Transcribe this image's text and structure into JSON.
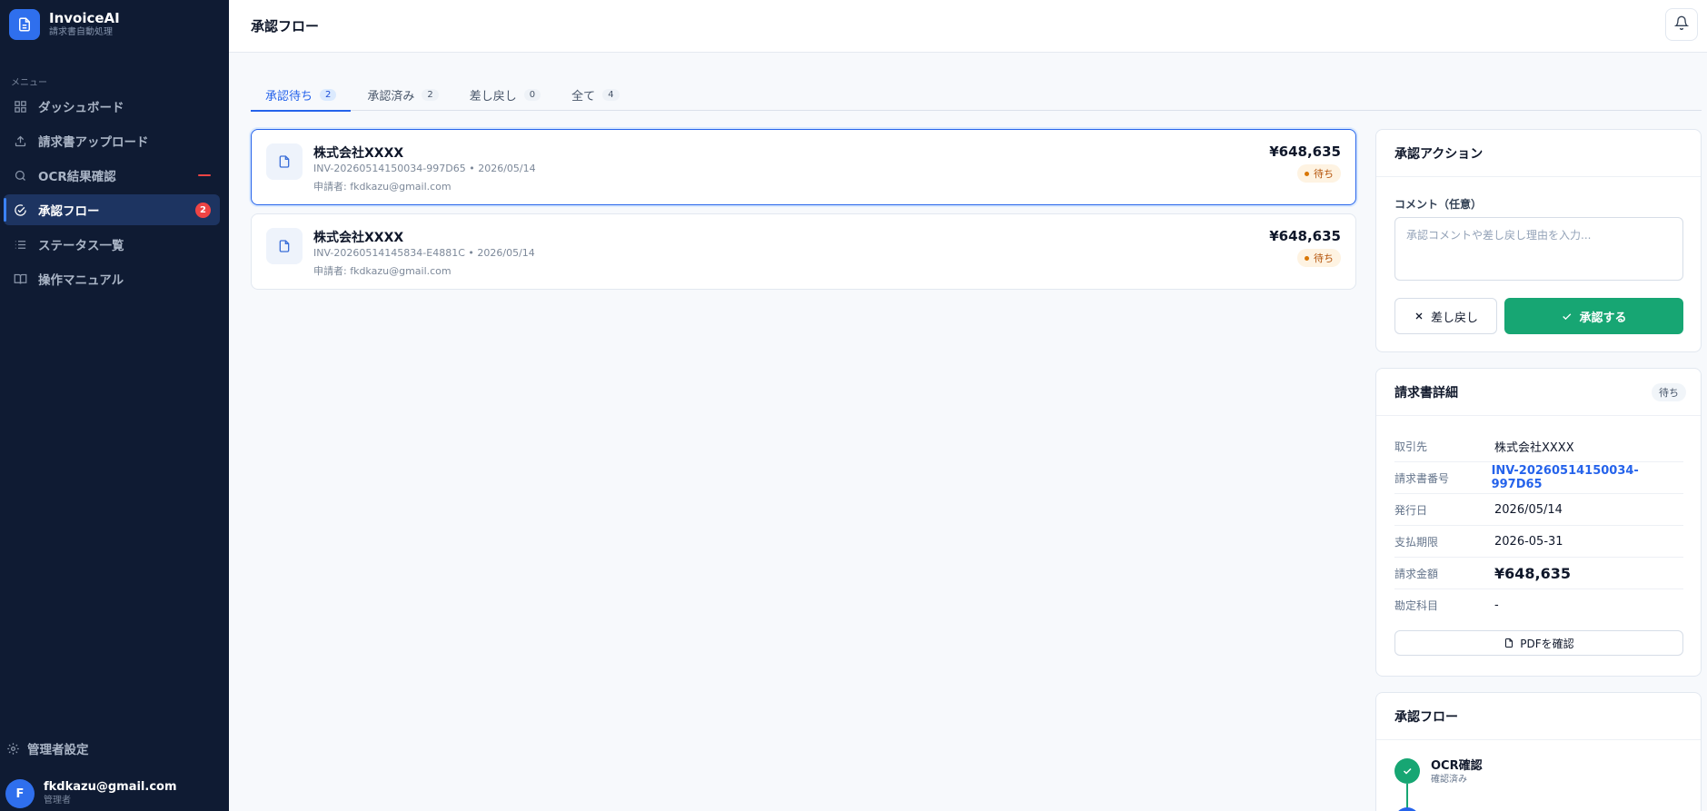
{
  "brand": {
    "name": "InvoiceAI",
    "subtitle": "請求書自動処理"
  },
  "sidebar": {
    "menu_label": "メニュー",
    "items": [
      {
        "label": "ダッシュボード",
        "icon": "grid-icon"
      },
      {
        "label": "請求書アップロード",
        "icon": "upload-icon"
      },
      {
        "label": "OCR結果確認",
        "icon": "search-icon"
      },
      {
        "label": "承認フロー",
        "icon": "check-circle-icon",
        "badge": "2"
      },
      {
        "label": "ステータス一覧",
        "icon": "list-icon"
      },
      {
        "label": "操作マニュアル",
        "icon": "book-icon"
      }
    ],
    "admin_settings": "管理者設定"
  },
  "user": {
    "initial": "F",
    "email": "fkdkazu@gmail.com",
    "role": "管理者"
  },
  "header": {
    "title": "承認フロー"
  },
  "tabs": [
    {
      "label": "承認待ち",
      "count": "2"
    },
    {
      "label": "承認済み",
      "count": "2"
    },
    {
      "label": "差し戻し",
      "count": "0"
    },
    {
      "label": "全て",
      "count": "4"
    }
  ],
  "invoices": [
    {
      "vendor": "株式会社XXXX",
      "meta": "INV-20260514150034-997D65 • 2026/05/14",
      "applicant": "申請者: fkdkazu@gmail.com",
      "amount": "¥648,635",
      "status": "待ち"
    },
    {
      "vendor": "株式会社XXXX",
      "meta": "INV-20260514145834-E4881C • 2026/05/14",
      "applicant": "申請者: fkdkazu@gmail.com",
      "amount": "¥648,635",
      "status": "待ち"
    }
  ],
  "action_panel": {
    "title": "承認アクション",
    "comment_label": "コメント（任意）",
    "comment_placeholder": "承認コメントや差し戻し理由を入力...",
    "comment_value": "",
    "reject_label": "差し戻し",
    "approve_label": "承認する"
  },
  "detail_panel": {
    "title": "請求書詳細",
    "badge": "待ち",
    "rows": [
      {
        "key": "取引先",
        "value": "株式会社XXXX"
      },
      {
        "key": "請求書番号",
        "value": "INV-20260514150034-997D65"
      },
      {
        "key": "発行日",
        "value": "2026/05/14"
      },
      {
        "key": "支払期限",
        "value": "2026-05-31"
      },
      {
        "key": "請求金額",
        "value": "¥648,635"
      },
      {
        "key": "勘定科目",
        "value": "-"
      }
    ],
    "pdf_button": "PDFを確認"
  },
  "flow_panel": {
    "title": "承認フロー",
    "steps": [
      {
        "title": "OCR確認",
        "status": "確認済み"
      }
    ]
  },
  "colors": {
    "sidebar_bg": "#0f1b33",
    "accent": "#2563eb",
    "approve": "#17a673",
    "badge_red": "#ef4444",
    "pending": "#b45309"
  }
}
